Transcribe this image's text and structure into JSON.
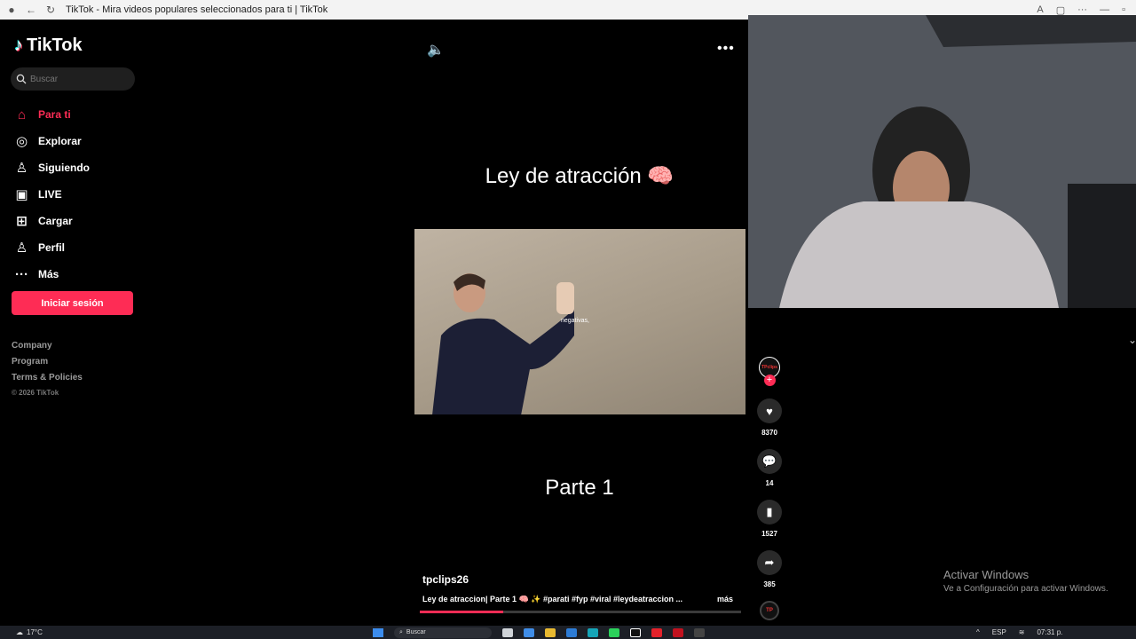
{
  "browser": {
    "title": "TikTok - Mira videos populares seleccionados para ti | TikTok"
  },
  "sidebar": {
    "logo": "TikTok",
    "search_placeholder": "Buscar",
    "items": [
      {
        "label": "Para ti",
        "icon": "home-icon",
        "active": true
      },
      {
        "label": "Explorar",
        "icon": "compass-icon",
        "active": false
      },
      {
        "label": "Siguiendo",
        "icon": "following-icon",
        "active": false
      },
      {
        "label": "LIVE",
        "icon": "live-icon",
        "active": false
      },
      {
        "label": "Cargar",
        "icon": "upload-icon",
        "active": false
      },
      {
        "label": "Perfil",
        "icon": "profile-icon",
        "active": false
      },
      {
        "label": "Más",
        "icon": "more-icon",
        "active": false
      }
    ],
    "login_label": "Iniciar sesión",
    "footer": {
      "company": "Company",
      "program": "Program",
      "terms": "Terms & Policies",
      "copyright": "© 2026 TikTok"
    }
  },
  "video": {
    "title": "Ley de atracción 🧠",
    "subtitle_overlay": "negativas,",
    "part_text": "Parte 1",
    "author": "tpclips26",
    "caption": "Ley de atraccion| Parte 1  🧠 ✨ #parati #fyp #viral #leydeatraccion ...",
    "caption_more": "más",
    "progress": 0.26
  },
  "actions": {
    "avatar_text": "TPclips",
    "likes": "8370",
    "comments": "14",
    "saves": "1527",
    "shares": "385"
  },
  "watermark": {
    "line1": "Activar Windows",
    "line2": "Ve a Configuración para activar Windows."
  },
  "taskbar": {
    "weather": "17°C",
    "search": "Buscar",
    "lang": "ESP",
    "time": "07:31 p."
  },
  "colors": {
    "accent": "#fe2c55",
    "background": "#000000"
  }
}
